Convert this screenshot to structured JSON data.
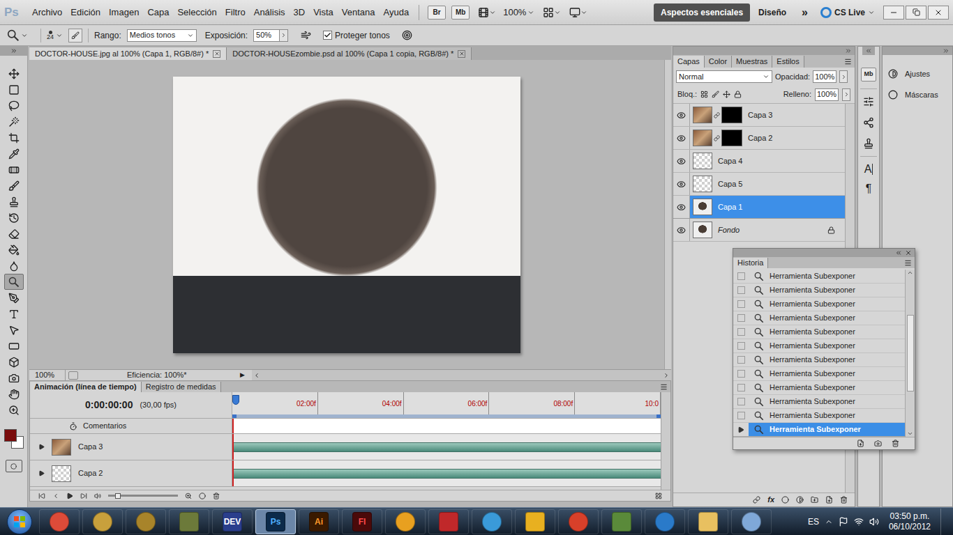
{
  "app": {
    "logo": "Ps"
  },
  "menu": [
    "Archivo",
    "Edición",
    "Imagen",
    "Capa",
    "Selección",
    "Filtro",
    "Análisis",
    "3D",
    "Vista",
    "Ventana",
    "Ayuda"
  ],
  "bridge_buttons": [
    "Br",
    "Mb"
  ],
  "view_zoom": "100%",
  "workspaces": [
    {
      "label": "Aspectos esenciales",
      "selected": true
    },
    {
      "label": "Diseño",
      "selected": false
    }
  ],
  "workspaces_more": "»",
  "cs_live": "CS Live",
  "options": {
    "brush_size": "24",
    "range_label": "Rango:",
    "range": "Medios tonos",
    "exposure_label": "Exposición:",
    "exposure": "50%",
    "protect_label": "Proteger tonos",
    "protect": true
  },
  "tools": [
    {
      "selected": false
    },
    {
      "selected": false
    },
    {
      "selected": false
    },
    {
      "selected": false
    },
    {
      "selected": false
    },
    {
      "selected": false
    },
    {
      "selected": false
    },
    {
      "selected": false
    },
    {
      "selected": false
    },
    {
      "selected": false
    },
    {
      "selected": false
    },
    {
      "selected": false
    },
    {
      "selected": false
    },
    {
      "selected": true
    },
    {
      "selected": false
    },
    {
      "selected": false
    },
    {
      "selected": false
    },
    {
      "selected": false
    },
    {
      "selected": false
    },
    {
      "selected": false
    },
    {
      "selected": false
    },
    {
      "selected": false
    }
  ],
  "swatches": {
    "foreground": "#7a0c0c",
    "background": "#ffffff"
  },
  "documents": [
    {
      "label": "DOCTOR-HOUSE.jpg al 100% (Capa 1, RGB/8#) *",
      "selected": true
    },
    {
      "label": "DOCTOR-HOUSEzombie.psd al 100% (Capa 1 copia, RGB/8#) *",
      "selected": false
    }
  ],
  "status": {
    "zoom": "100%",
    "info": "Eficiencia: 100%*",
    "arrow": "▶"
  },
  "timeline": {
    "tabs": [
      {
        "label": "Animación (línea de tiempo)",
        "selected": true
      },
      {
        "label": "Registro de medidas",
        "selected": false
      }
    ],
    "time": "0:00:00:00",
    "fps": "(30,00 fps)",
    "ticks": [
      "02:00f",
      "04:00f",
      "06:00f",
      "08:00f",
      "10:0"
    ],
    "comments": "Comentarios",
    "layers": [
      {
        "name": "Capa 3",
        "kind": "photo"
      },
      {
        "name": "Capa 2",
        "kind": "transparent"
      }
    ]
  },
  "layers_panel": {
    "tabs": [
      {
        "label": "Capas",
        "selected": true
      },
      {
        "label": "Color",
        "selected": false
      },
      {
        "label": "Muestras",
        "selected": false
      },
      {
        "label": "Estilos",
        "selected": false
      }
    ],
    "blend": "Normal",
    "opacity_label": "Opacidad:",
    "opacity": "100%",
    "lock_label": "Bloq.:",
    "fill_label": "Relleno:",
    "fill": "100%",
    "fx": "fx",
    "layers": [
      {
        "name": "Capa 3",
        "visible": true,
        "selected": false,
        "mask": true,
        "locked": false,
        "italic": false,
        "kind": "photo"
      },
      {
        "name": "Capa 2",
        "visible": true,
        "selected": false,
        "mask": true,
        "locked": false,
        "italic": false,
        "kind": "photo"
      },
      {
        "name": "Capa 4",
        "visible": true,
        "selected": false,
        "mask": false,
        "locked": false,
        "italic": false,
        "kind": "transparent"
      },
      {
        "name": "Capa 5",
        "visible": true,
        "selected": false,
        "mask": false,
        "locked": false,
        "italic": false,
        "kind": "transparent"
      },
      {
        "name": "Capa 1",
        "visible": true,
        "selected": true,
        "mask": false,
        "locked": false,
        "italic": false,
        "kind": "portrait"
      },
      {
        "name": "Fondo",
        "visible": true,
        "selected": false,
        "mask": false,
        "locked": true,
        "italic": true,
        "kind": "portrait"
      }
    ]
  },
  "dock_icons": [
    "Mb",
    "A",
    "¶"
  ],
  "adjustments": [
    {
      "label": "Ajustes"
    },
    {
      "label": "Máscaras"
    }
  ],
  "history": {
    "title": "Historia",
    "items": [
      {
        "label": "Herramienta Subexponer",
        "selected": false
      },
      {
        "label": "Herramienta Subexponer",
        "selected": false
      },
      {
        "label": "Herramienta Subexponer",
        "selected": false
      },
      {
        "label": "Herramienta Subexponer",
        "selected": false
      },
      {
        "label": "Herramienta Subexponer",
        "selected": false
      },
      {
        "label": "Herramienta Subexponer",
        "selected": false
      },
      {
        "label": "Herramienta Subexponer",
        "selected": false
      },
      {
        "label": "Herramienta Subexponer",
        "selected": false
      },
      {
        "label": "Herramienta Subexponer",
        "selected": false
      },
      {
        "label": "Herramienta Subexponer",
        "selected": false
      },
      {
        "label": "Herramienta Subexponer",
        "selected": false
      },
      {
        "label": "Herramienta Subexponer",
        "selected": true
      }
    ]
  },
  "taskbar": {
    "apps": [
      {
        "kind": "round",
        "color": "#dd4b39",
        "selected": false
      },
      {
        "kind": "round",
        "color": "#c8a03c",
        "selected": false
      },
      {
        "kind": "round",
        "color": "#a8842a",
        "selected": false
      },
      {
        "kind": "tile",
        "color": "#6c7a3a",
        "selected": false
      },
      {
        "kind": "tile",
        "color": "#2a3e8c",
        "label": "DEV",
        "text_color": "#ffffff",
        "selected": false
      },
      {
        "kind": "tile",
        "color": "#0c2a4a",
        "label": "Ps",
        "text_color": "#4fb0ff",
        "selected": true
      },
      {
        "kind": "tile",
        "color": "#3a1a00",
        "label": "Ai",
        "text_color": "#ff9a2a",
        "selected": false
      },
      {
        "kind": "tile",
        "color": "#4a0a0a",
        "label": "Fl",
        "text_color": "#ff4a4a",
        "selected": false
      },
      {
        "kind": "round",
        "color": "#e8a020",
        "selected": false
      },
      {
        "kind": "tile",
        "color": "#c0282a",
        "selected": false
      },
      {
        "kind": "round",
        "color": "#3a9ad9",
        "selected": false
      },
      {
        "kind": "tile",
        "color": "#e8b020",
        "selected": false
      },
      {
        "kind": "round",
        "color": "#d8402a",
        "selected": false
      },
      {
        "kind": "tile",
        "color": "#5a8a3a",
        "selected": false
      },
      {
        "kind": "round",
        "color": "#2a7ac9",
        "selected": false
      },
      {
        "kind": "tile",
        "color": "#e8c060",
        "selected": false
      },
      {
        "kind": "round",
        "color": "#7fa8d8",
        "selected": false
      }
    ],
    "language": "ES",
    "time": "03:50 p.m.",
    "date": "06/10/2012"
  }
}
